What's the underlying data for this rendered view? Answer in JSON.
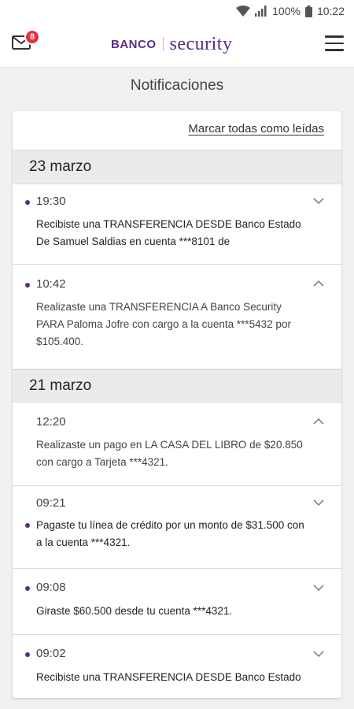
{
  "status_bar": {
    "battery": "100%",
    "time": "10:22"
  },
  "header": {
    "mail_badge": "8",
    "logo_banco": "BANCO",
    "logo_security": "security"
  },
  "page": {
    "title": "Notificaciones",
    "mark_all_label": "Marcar todas como leídas"
  },
  "groups": [
    {
      "date": "23 marzo",
      "items": [
        {
          "time": "19:30",
          "unread": true,
          "expanded": false,
          "message": "Recibiste una TRANSFERENCIA DESDE Banco Estado De Samuel Saldias en cuenta ***8101 de"
        },
        {
          "time": "10:42",
          "unread": true,
          "expanded": true,
          "message": "Realizaste una TRANSFERENCIA A Banco Security PARA Paloma Jofre con cargo a la cuenta ***5432 por $105.400."
        }
      ]
    },
    {
      "date": "21 marzo",
      "items": [
        {
          "time": "12:20",
          "unread": false,
          "expanded": true,
          "message": "Realizaste un pago en LA CASA DEL LIBRO de $20.850 con cargo a Tarjeta ***4321."
        },
        {
          "time": "09:21",
          "unread": true,
          "expanded": false,
          "message": "Pagaste tu línea de crédito por un monto de $31.500 con a la cuenta ***4321."
        },
        {
          "time": "09:08",
          "unread": true,
          "expanded": false,
          "message": "Giraste $60.500 desde tu cuenta ***4321."
        },
        {
          "time": "09:02",
          "unread": true,
          "expanded": false,
          "message": "Recibiste una TRANSFERENCIA DESDE Banco Estado"
        }
      ]
    }
  ]
}
